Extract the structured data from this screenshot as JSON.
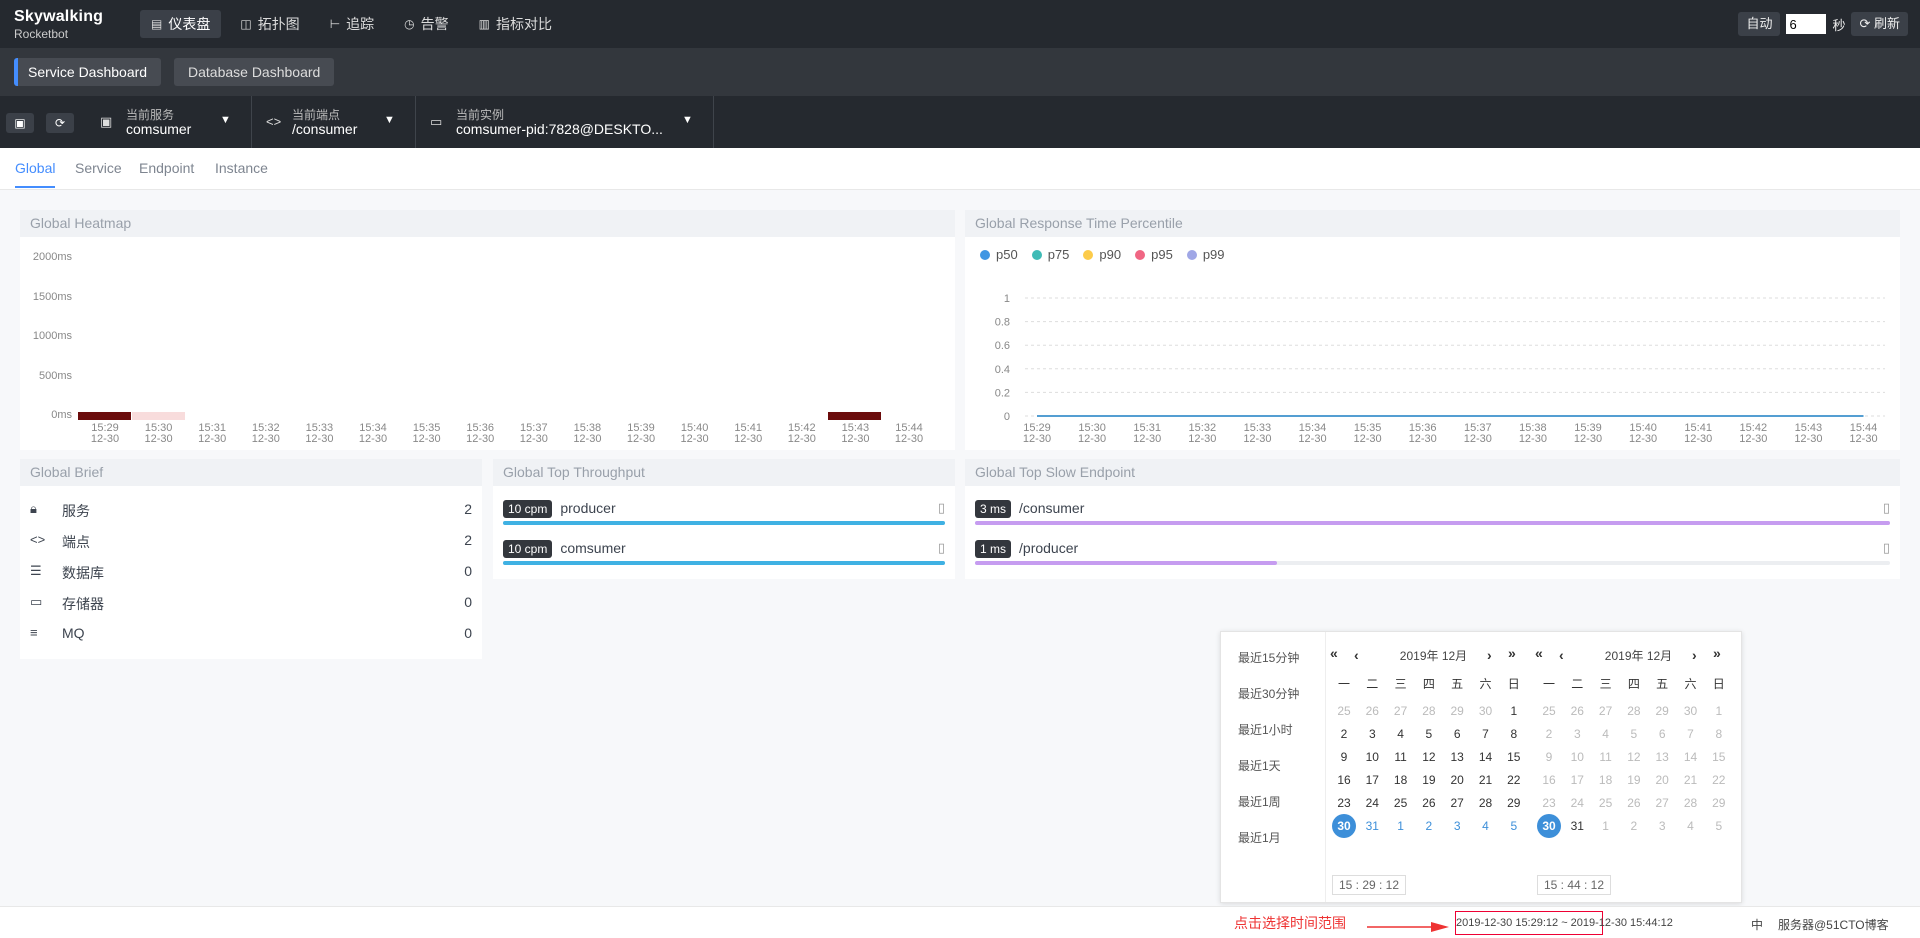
{
  "logo": {
    "line1": "Skywalking",
    "line2": "Rocketbot"
  },
  "nav": [
    {
      "icon": "bar-chart-icon",
      "glyph": "▤",
      "label": "仪表盘",
      "active": true
    },
    {
      "icon": "topology-icon",
      "glyph": "◫",
      "label": "拓扑图"
    },
    {
      "icon": "trace-icon",
      "glyph": "⊢",
      "label": "追踪"
    },
    {
      "icon": "alarm-icon",
      "glyph": "◷",
      "label": "告警"
    },
    {
      "icon": "compare-icon",
      "glyph": "▥",
      "label": "指标对比"
    }
  ],
  "topright": {
    "auto_label": "自动",
    "interval": "6",
    "sec_label": "秒",
    "refresh_label": "刷新"
  },
  "dash_tabs": [
    "Service Dashboard",
    "Database Dashboard"
  ],
  "selectors": {
    "service": {
      "label": "当前服务",
      "value": "comsumer"
    },
    "endpoint": {
      "label": "当前端点",
      "value": "/consumer"
    },
    "instance": {
      "label": "当前实例",
      "value": "comsumer-pid:7828@DESKTO..."
    }
  },
  "sub_tabs": [
    "Global",
    "Service",
    "Endpoint",
    "Instance"
  ],
  "heatmap": {
    "title": "Global Heatmap",
    "yticks": [
      "2000ms",
      "1500ms",
      "1000ms",
      "500ms",
      "0ms"
    ]
  },
  "times": [
    "15:29",
    "15:30",
    "15:31",
    "15:32",
    "15:33",
    "15:34",
    "15:35",
    "15:36",
    "15:37",
    "15:38",
    "15:39",
    "15:40",
    "15:41",
    "15:42",
    "15:43",
    "15:44"
  ],
  "date": "12-30",
  "chart_data": [
    {
      "type": "heatmap",
      "title": "Global Heatmap",
      "x": [
        "15:29",
        "15:30",
        "15:31",
        "15:32",
        "15:33",
        "15:34",
        "15:35",
        "15:36",
        "15:37",
        "15:38",
        "15:39",
        "15:40",
        "15:41",
        "15:42",
        "15:43",
        "15:44"
      ],
      "y": [
        "0ms",
        "500ms",
        "1000ms",
        "1500ms",
        "2000ms"
      ],
      "cells": [
        {
          "x": "15:29",
          "y": "0ms",
          "level": "high"
        },
        {
          "x": "15:30",
          "y": "0ms",
          "level": "low"
        },
        {
          "x": "15:43",
          "y": "0ms",
          "level": "high"
        }
      ]
    },
    {
      "type": "line",
      "title": "Global Response Time Percentile",
      "x": [
        "15:29",
        "15:30",
        "15:31",
        "15:32",
        "15:33",
        "15:34",
        "15:35",
        "15:36",
        "15:37",
        "15:38",
        "15:39",
        "15:40",
        "15:41",
        "15:42",
        "15:43",
        "15:44"
      ],
      "ylim": [
        0,
        1
      ],
      "yticks": [
        "1",
        "0.8",
        "0.6",
        "0.4",
        "0.2",
        "0"
      ],
      "series": [
        {
          "name": "p50",
          "color": "#3f96e3",
          "values": [
            0,
            0,
            0,
            0,
            0,
            0,
            0,
            0,
            0,
            0,
            0,
            0,
            0,
            0,
            0,
            0
          ]
        },
        {
          "name": "p75",
          "color": "#3fbbb6",
          "values": [
            0,
            0,
            0,
            0,
            0,
            0,
            0,
            0,
            0,
            0,
            0,
            0,
            0,
            0,
            0,
            0
          ]
        },
        {
          "name": "p90",
          "color": "#fccb4a",
          "values": [
            0,
            0,
            0,
            0,
            0,
            0,
            0,
            0,
            0,
            0,
            0,
            0,
            0,
            0,
            0,
            0
          ]
        },
        {
          "name": "p95",
          "color": "#f06683",
          "values": [
            0,
            0,
            0,
            0,
            0,
            0,
            0,
            0,
            0,
            0,
            0,
            0,
            0,
            0,
            0,
            0
          ]
        },
        {
          "name": "p99",
          "color": "#a0a7e6",
          "values": [
            0,
            0,
            0,
            0,
            0,
            0,
            0,
            0,
            0,
            0,
            0,
            0,
            0,
            0,
            0,
            0
          ]
        }
      ],
      "legend": "top-left"
    }
  ],
  "percentile": {
    "title": "Global Response Time Percentile"
  },
  "brief": {
    "title": "Global Brief",
    "items": [
      {
        "icon": "lock-icon",
        "glyph": "🔒︎",
        "label": "服务",
        "value": "2"
      },
      {
        "icon": "code-icon",
        "glyph": "<>",
        "label": "端点",
        "value": "2"
      },
      {
        "icon": "database-icon",
        "glyph": "☰",
        "label": "数据库",
        "value": "0"
      },
      {
        "icon": "storage-icon",
        "glyph": "▭",
        "label": "存储器",
        "value": "0"
      },
      {
        "icon": "mq-icon",
        "glyph": "≡",
        "label": "MQ",
        "value": "0"
      }
    ]
  },
  "throughput": {
    "title": "Global Top Throughput",
    "color": "#3fb1e3",
    "items": [
      {
        "badge": "10 cpm",
        "name": "producer",
        "ratio": 1
      },
      {
        "badge": "10 cpm",
        "name": "comsumer",
        "ratio": 1
      }
    ]
  },
  "slow": {
    "title": "Global Top Slow Endpoint",
    "color": "#c69cf0",
    "items": [
      {
        "badge": "3 ms",
        "name": "/consumer",
        "ratio": 1
      },
      {
        "badge": "1 ms",
        "name": "/producer",
        "ratio": 0.33
      }
    ]
  },
  "picker": {
    "quick": [
      "最近15分钟",
      "最近30分钟",
      "最近1小时",
      "最近1天",
      "最近1周",
      "最近1月"
    ],
    "weekdays": [
      "一",
      "二",
      "三",
      "四",
      "五",
      "六",
      "日"
    ],
    "left": {
      "title": "2019年 12月",
      "time": "15 : 29 : 12",
      "days": [
        "25",
        "26",
        "27",
        "28",
        "29",
        "30",
        "1",
        "2",
        "3",
        "4",
        "5",
        "6",
        "7",
        "8",
        "9",
        "10",
        "11",
        "12",
        "13",
        "14",
        "15",
        "16",
        "17",
        "18",
        "19",
        "20",
        "21",
        "22",
        "23",
        "24",
        "25",
        "26",
        "27",
        "28",
        "29",
        "30",
        "31",
        "1",
        "2",
        "3",
        "4",
        "5"
      ]
    },
    "right": {
      "title": "2019年 12月",
      "time": "15 : 44 : 12",
      "days": [
        "25",
        "26",
        "27",
        "28",
        "29",
        "30",
        "1",
        "2",
        "3",
        "4",
        "5",
        "6",
        "7",
        "8",
        "9",
        "10",
        "11",
        "12",
        "13",
        "14",
        "15",
        "16",
        "17",
        "18",
        "19",
        "20",
        "21",
        "22",
        "23",
        "24",
        "25",
        "26",
        "27",
        "28",
        "29",
        "30",
        "31",
        "1",
        "2",
        "3",
        "4",
        "5"
      ]
    }
  },
  "footer": {
    "hint": "点击选择时间范围",
    "range": "2019-12-30 15:29:12 ~ 2019-12-30 15:44:12",
    "lang": "中",
    "server": "服务器@51CTO博客"
  }
}
